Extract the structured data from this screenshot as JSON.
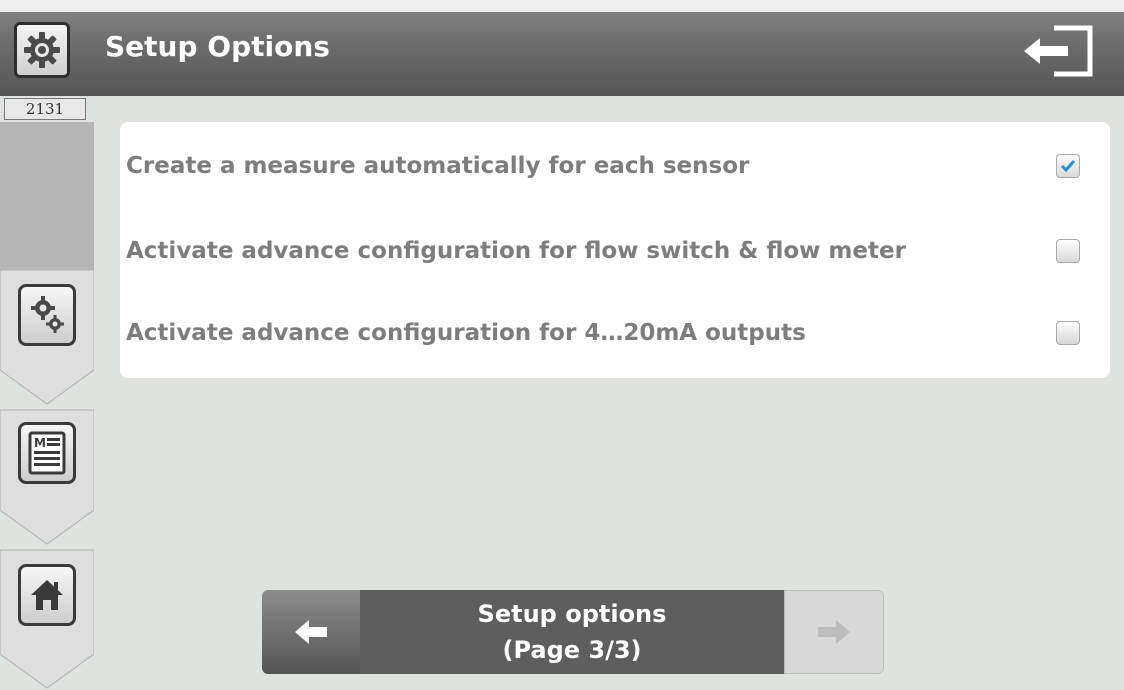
{
  "header": {
    "title": "Setup Options",
    "settings_icon": "gear-icon",
    "exit_icon": "exit-arrow-icon"
  },
  "badge": {
    "id": "2131"
  },
  "sidebar": {
    "items": [
      {
        "icon": "settings-gears-icon"
      },
      {
        "icon": "menu-list-icon"
      },
      {
        "icon": "home-icon"
      }
    ]
  },
  "options": [
    {
      "label": "Create a measure automatically for each sensor",
      "checked": true
    },
    {
      "label": "Activate advance configuration for flow switch & flow meter",
      "checked": false
    },
    {
      "label": "Activate advance configuration for 4…20mA outputs",
      "checked": false
    }
  ],
  "pager": {
    "line1": "Setup options",
    "line2": "(Page 3/3)",
    "prev_icon": "arrow-left-icon",
    "next_icon": "arrow-right-icon"
  },
  "colors": {
    "header_gray": "#6e6e6e",
    "check_blue": "#2b8fd6",
    "label_gray": "#7d7d7d"
  }
}
